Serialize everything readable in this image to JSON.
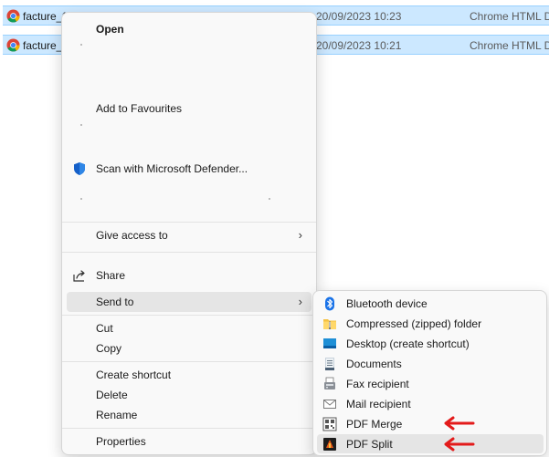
{
  "files": [
    {
      "name": "facture_f",
      "date": "20/09/2023 10:23",
      "type": "Chrome HTML D"
    },
    {
      "name": "facture_",
      "date": "20/09/2023 10:21",
      "type": "Chrome HTML D"
    }
  ],
  "menu": {
    "open": "Open",
    "add_favourites": "Add to Favourites",
    "scan": "Scan with Microsoft Defender...",
    "give_access": "Give access to",
    "share": "Share",
    "send_to": "Send to",
    "cut": "Cut",
    "copy": "Copy",
    "create_shortcut": "Create shortcut",
    "delete": "Delete",
    "rename": "Rename",
    "properties": "Properties",
    "chevron": "›"
  },
  "send_to": {
    "items": [
      {
        "label": "Bluetooth device",
        "icon": "bluetooth-icon"
      },
      {
        "label": "Compressed (zipped) folder",
        "icon": "zip-folder-icon"
      },
      {
        "label": "Desktop (create shortcut)",
        "icon": "desktop-icon"
      },
      {
        "label": "Documents",
        "icon": "documents-icon"
      },
      {
        "label": "Fax recipient",
        "icon": "fax-icon"
      },
      {
        "label": "Mail recipient",
        "icon": "mail-icon"
      },
      {
        "label": "PDF Merge",
        "icon": "pdf-merge-icon"
      },
      {
        "label": "PDF Split",
        "icon": "pdf-split-icon"
      }
    ]
  },
  "colors": {
    "selection": "#cce8ff",
    "accent": "#0078d4",
    "annotation_arrow": "#e31b1b"
  }
}
